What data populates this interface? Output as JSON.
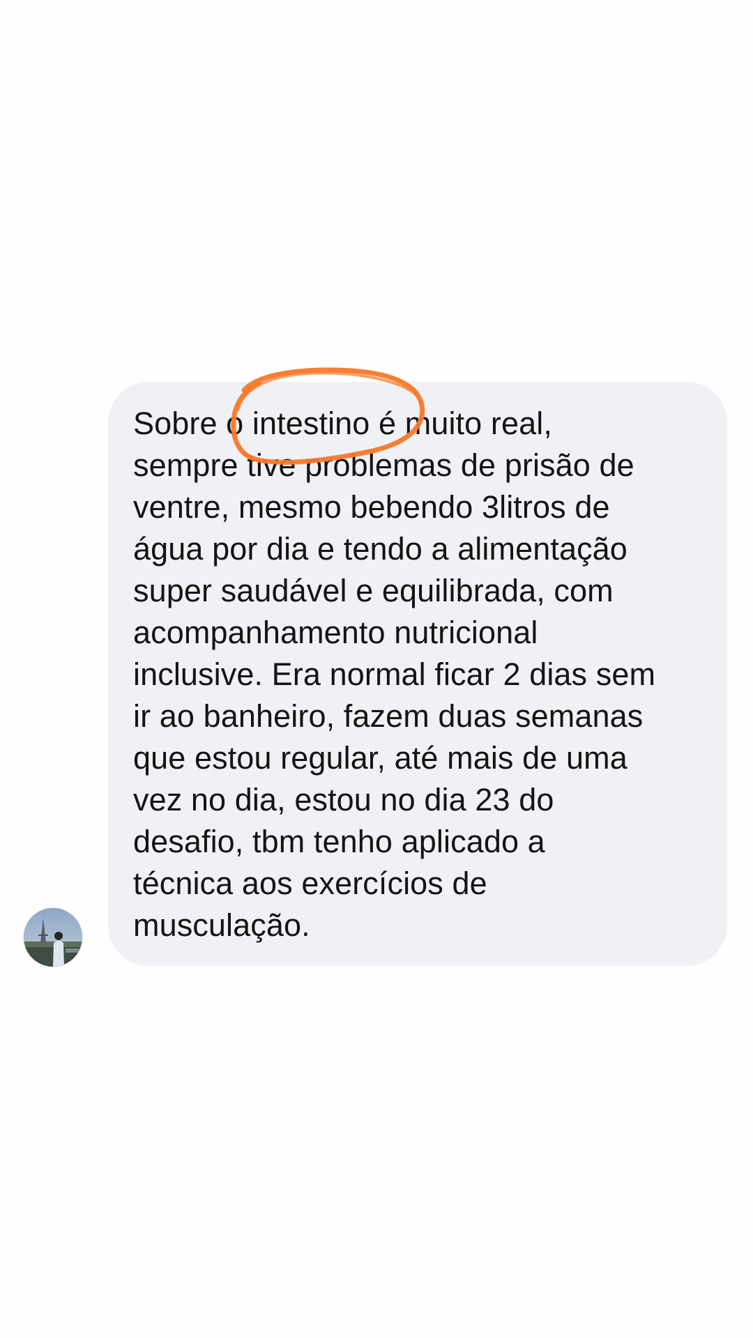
{
  "conversation": {
    "message": {
      "text": "Sobre o intestino é muito real,\nsempre tive problemas de prisão de\nventre, mesmo bebendo 3litros de\nágua por dia e tendo a alimentação\nsuper saudável e equilibrada, com\nacompanhamento nutricional\ninclusive. Era normal ficar 2 dias sem\nir ao banheiro, fazem duas semanas\nque estou regular, até mais de uma\nvez no dia, estou no dia 23 do\ndesafio, tbm tenho aplicado a\ntécnica aos exercícios de\nmusculação."
    },
    "sender_avatar_icon": "profile-photo-eiffel-tower"
  },
  "annotation": {
    "shape": "hand-drawn-circle",
    "color": "#f7782a"
  },
  "colors": {
    "background": "#fefefe",
    "bubble": "#eff1f4",
    "text": "#141414"
  }
}
